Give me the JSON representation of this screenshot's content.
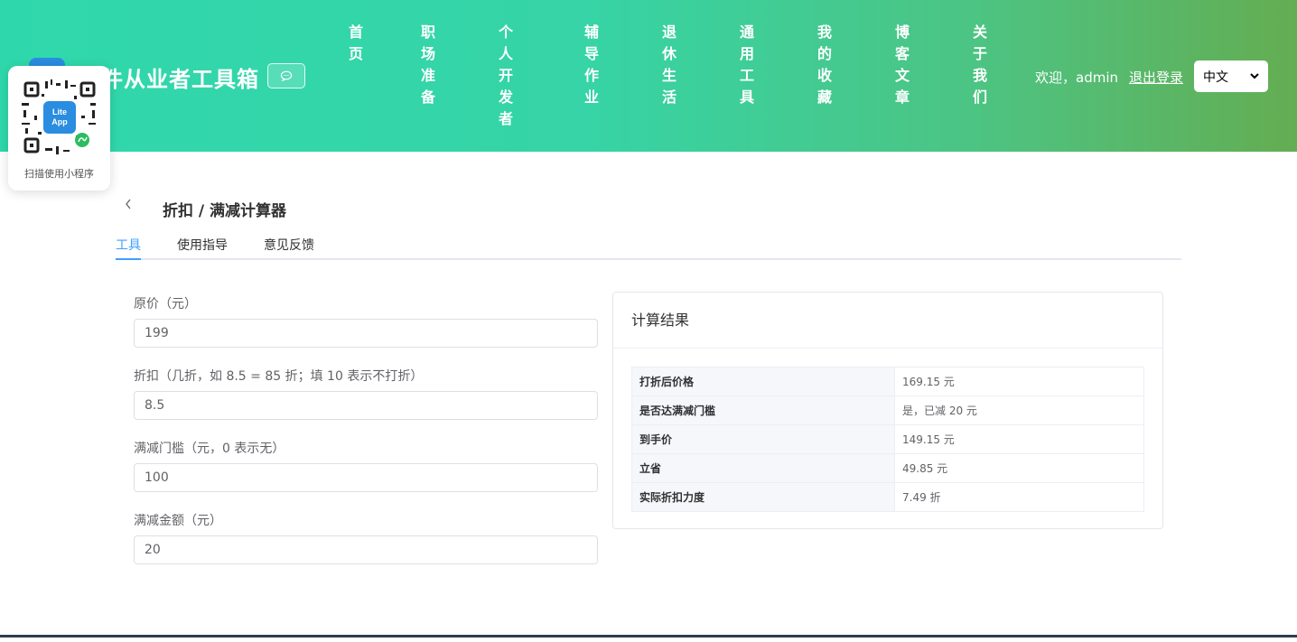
{
  "header": {
    "site_title": "件从业者工具箱",
    "nav": [
      {
        "label": "首页"
      },
      {
        "label": "职场准备"
      },
      {
        "label": "个人开发者"
      },
      {
        "label": "辅导作业"
      },
      {
        "label": "退休生活"
      },
      {
        "label": "通用工具"
      },
      {
        "label": "我的收藏"
      },
      {
        "label": "博客文章"
      },
      {
        "label": "关于我们"
      }
    ],
    "welcome": "欢迎，admin",
    "logout": "退出登录",
    "language": "中文",
    "icons": {
      "chat": "chat-bubble-icon",
      "logo": "app-logo-icon"
    }
  },
  "qr": {
    "logo_text_1": "Lite",
    "logo_text_2": "App",
    "caption": "扫描使用小程序"
  },
  "page": {
    "title": "折扣 / 满减计算器",
    "tabs": [
      {
        "label": "工具"
      },
      {
        "label": "使用指导"
      },
      {
        "label": "意见反馈"
      }
    ]
  },
  "form": {
    "fields": [
      {
        "label": "原价（元）",
        "value": "199"
      },
      {
        "label": "折扣（几折，如 8.5 = 85 折；填 10 表示不打折）",
        "value": "8.5"
      },
      {
        "label": "满减门槛（元，0 表示无）",
        "value": "100"
      },
      {
        "label": "满减金额（元）",
        "value": "20"
      }
    ]
  },
  "result": {
    "title": "计算结果",
    "rows": [
      {
        "key": "打折后价格",
        "value": "169.15 元"
      },
      {
        "key": "是否达满减门槛",
        "value": "是，已减 20 元"
      },
      {
        "key": "到手价",
        "value": "149.15 元"
      },
      {
        "key": "立省",
        "value": "49.85 元"
      },
      {
        "key": "实际折扣力度",
        "value": "7.49 折"
      }
    ]
  },
  "colors": {
    "accent": "#409eff",
    "header_start": "#2fd8ac",
    "header_end": "#64ad52"
  }
}
